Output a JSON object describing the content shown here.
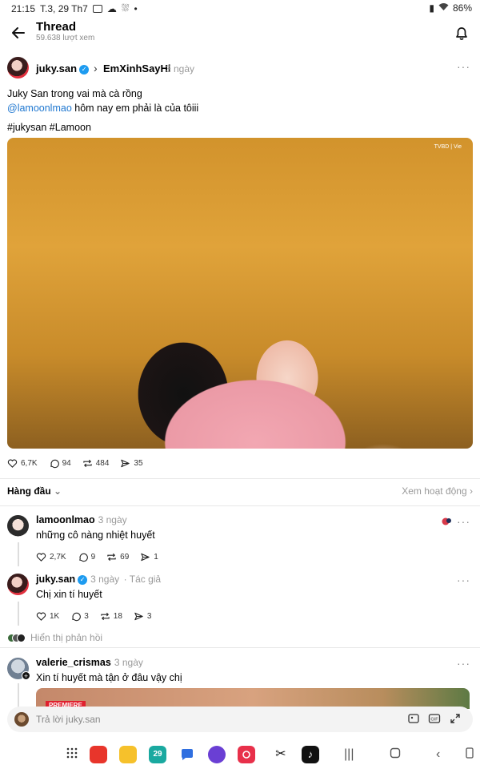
{
  "status_bar": {
    "time": "21:15",
    "date": "T.3, 29 Th7",
    "battery": "86%"
  },
  "header": {
    "title": "Thread",
    "views": "59.638 lượt xem"
  },
  "post": {
    "author": "juky.san",
    "community": "EmXinhSayHi",
    "time": "3 ngày",
    "text_line1": "Juky San trong vai mà cà rồng",
    "mention": "@lamoonlmao",
    "text_line2_rest": " hôm nay em phải là của tôiii",
    "hashtags": "#jukysan #Lamoon",
    "image_overlay": "TVBD | Vie",
    "stats": {
      "likes": "6,7K",
      "comments": "94",
      "reposts": "484",
      "shares": "35"
    }
  },
  "sort": {
    "label": "Hàng đầu",
    "activity_link": "Xem hoạt động"
  },
  "comments": [
    {
      "user": "lamoonlmao",
      "time": "3 ngày",
      "text": "những cô nàng nhiệt huyết",
      "stats": {
        "likes": "2,7K",
        "comments": "9",
        "reposts": "69",
        "shares": "1"
      }
    },
    {
      "user": "juky.san",
      "time": "3 ngày",
      "author_tag": "· Tác giả",
      "text": "Chị xin tí huyết",
      "stats": {
        "likes": "1K",
        "comments": "3",
        "reposts": "18",
        "shares": "3"
      }
    },
    {
      "user": "valerie_crismas",
      "time": "3 ngày",
      "text": "Xin tí huyết mà tận ở đâu vậy chị",
      "image_badge": "PREMIERE"
    }
  ],
  "show_replies": "Hiển thị phản hồi",
  "reply_bar": {
    "placeholder": "Trả lời juky.san"
  },
  "nav": {
    "calendar_day": "29",
    "apps": [
      "app-drawer-icon",
      "flipboard-icon",
      "files-icon",
      "calendar-icon",
      "messages-icon",
      "internet-icon",
      "camera-icon",
      "capcut-icon",
      "tiktok-icon"
    ]
  }
}
